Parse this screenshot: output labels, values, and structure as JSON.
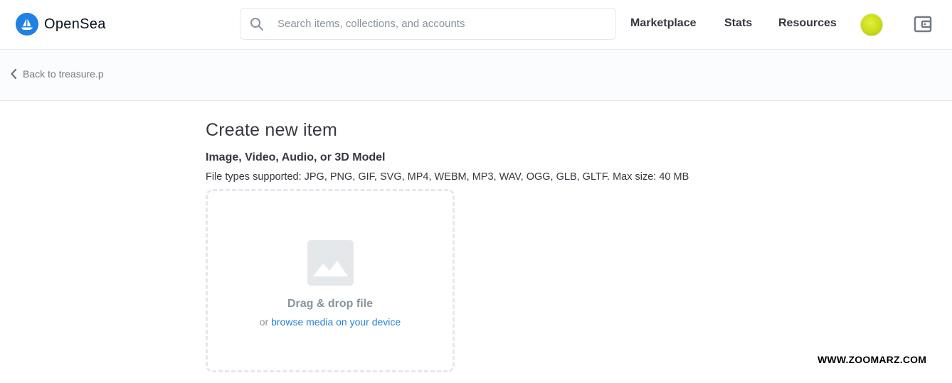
{
  "header": {
    "brand": "OpenSea",
    "search_placeholder": "Search items, collections, and accounts",
    "nav": {
      "marketplace": "Marketplace",
      "stats": "Stats",
      "resources": "Resources"
    },
    "icons": {
      "logo": "opensea-logo-icon",
      "search": "search-icon",
      "avatar": "avatar",
      "wallet": "wallet-icon"
    }
  },
  "subbar": {
    "back_label": "Back to treasure.p"
  },
  "form": {
    "title": "Create new item",
    "media_label": "Image, Video, Audio, or 3D Model",
    "media_hint": "File types supported: JPG, PNG, GIF, SVG, MP4, WEBM, MP3, WAV, OGG, GLB, GLTF. Max size: 40 MB",
    "dropzone": {
      "title": "Drag & drop file",
      "or": "or",
      "browse": "browse media on your device",
      "icon": "image-placeholder-icon"
    }
  },
  "watermark": "WWW.ZOOMARZ.COM",
  "colors": {
    "brand": "#2081e2",
    "text": "#353840",
    "muted": "#8a939b",
    "border": "#e5e8eb",
    "avatar": "#c8dc1a"
  }
}
